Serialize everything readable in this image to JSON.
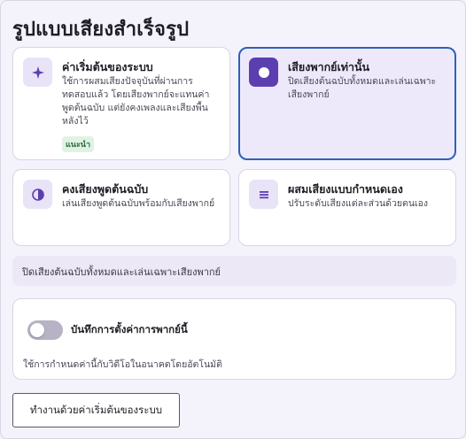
{
  "page": {
    "title": "รูปแบบเสียงสำเร็จรูป"
  },
  "presets": [
    {
      "id": "default",
      "icon": "sparkle-icon",
      "title": "ค่าเริ่มต้นของระบบ",
      "description": "ใช้การผสมเสียงปัจจุบันที่ผ่านการทดสอบแล้ว โดยเสียงพากย์จะแทนค่าพูดต้นฉบับ แต่ยังคงเพลงและเสียงพื้นหลังไว้",
      "badge": "แนะนำ",
      "selected": false
    },
    {
      "id": "dub-only",
      "icon": "record-circle-icon",
      "title": "เสียงพากย์เท่านั้น",
      "description": "ปิดเสียงต้นฉบับทั้งหมดและเล่นเฉพาะเสียงพากย์",
      "selected": true
    },
    {
      "id": "keep-original",
      "icon": "half-circle-icon",
      "title": "คงเสียงพูดต้นฉบับ",
      "description": "เล่นเสียงพูดต้นฉบับพร้อมกับเสียงพากย์",
      "selected": false
    },
    {
      "id": "custom",
      "icon": "sliders-icon",
      "title": "ผสมเสียงแบบกำหนดเอง",
      "description": "ปรับระดับเสียงแต่ละส่วนด้วยตนเอง",
      "selected": false
    }
  ],
  "status": {
    "text": "ปิดเสียงต้นฉบับทั้งหมดและเล่นเฉพาะเสียงพากย์"
  },
  "save_setting": {
    "toggle_on": false,
    "label": "บันทึกการตั้งค่าการพากย์นี้",
    "help": "ใช้การกำหนดค่านี้กับวิดีโอในอนาคตโดยอัตโนมัติ"
  },
  "actions": {
    "use_default_label": "ทำงานด้วยค่าเริ่มต้นของระบบ"
  },
  "colors": {
    "accent": "#5b3fb0",
    "selected_border": "#2d62b7",
    "selected_bg": "#ede9fb",
    "badge_bg": "#dff2e3",
    "badge_text": "#2b6b3c"
  }
}
